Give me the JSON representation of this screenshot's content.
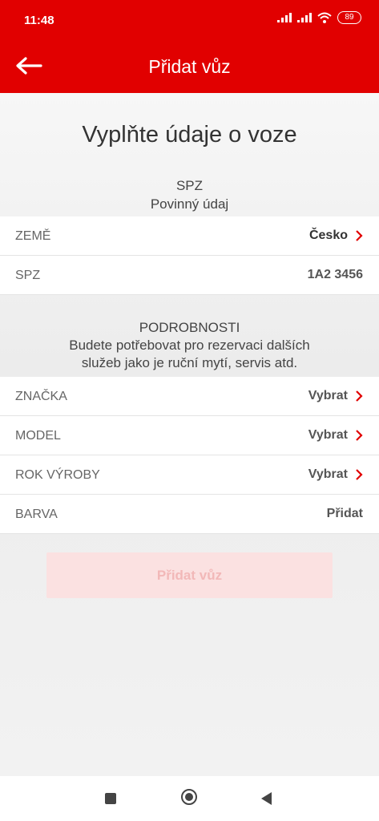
{
  "status_bar": {
    "time": "11:48",
    "battery": "89"
  },
  "app_bar": {
    "title": "Přidat vůz"
  },
  "main": {
    "heading": "Vyplňte údaje o voze",
    "spz_section": {
      "title": "SPZ",
      "subtitle": "Povinný údaj"
    },
    "spz_rows": [
      {
        "label": "ZEMĚ",
        "value": "Česko"
      },
      {
        "label": "SPZ",
        "value": "1A2 3456"
      }
    ],
    "details_section": {
      "title": "PODROBNOSTI",
      "line1": "Budete potřebovat pro rezervaci dalších",
      "line2": "služeb jako je ruční mytí, servis atd."
    },
    "detail_rows": [
      {
        "label": "ZNAČKA",
        "value": "Vybrat"
      },
      {
        "label": "MODEL",
        "value": "Vybrat"
      },
      {
        "label": "ROK VÝROBY",
        "value": "Vybrat"
      },
      {
        "label": "BARVA",
        "value": "Přidat"
      }
    ],
    "add_button": "Přidat vůz"
  },
  "colors": {
    "brand": "#e10000",
    "button_disabled_bg": "#fbe1e1",
    "button_disabled_text": "#f2b8b8"
  }
}
